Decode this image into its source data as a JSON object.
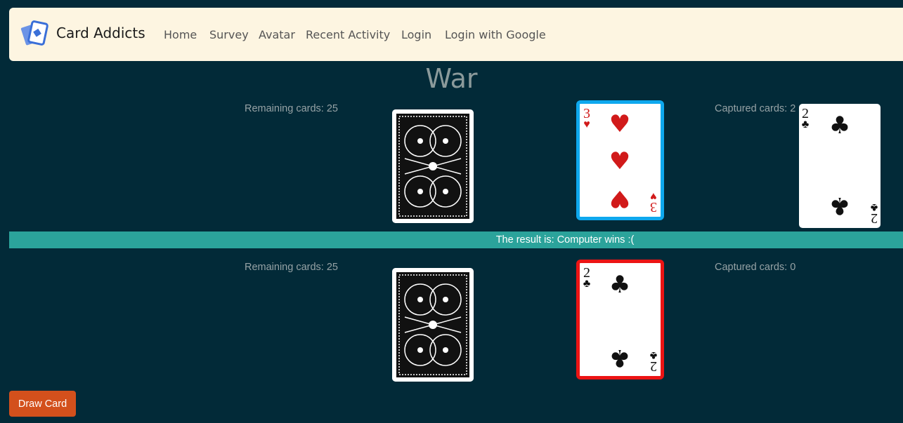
{
  "navbar": {
    "brand": "Card Addicts",
    "links": [
      "Home",
      "Survey",
      "Avatar",
      "Recent Activity",
      "Login",
      "Login with Google"
    ]
  },
  "page": {
    "title": "War"
  },
  "computer": {
    "remaining_label": "Remaining cards: 25",
    "captured_label": "Captured cards: 2",
    "played_card": {
      "rank": "3",
      "suit": "♥",
      "color": "red",
      "highlight": "#0ea8ee"
    },
    "captured_top_card": {
      "rank": "2",
      "suit": "♣",
      "color": "black"
    }
  },
  "result": {
    "text": "The result is: Computer wins :("
  },
  "player": {
    "remaining_label": "Remaining cards: 25",
    "captured_label": "Captured cards: 0",
    "played_card": {
      "rank": "2",
      "suit": "♣",
      "color": "black",
      "highlight": "#ec1414"
    }
  },
  "actions": {
    "draw_label": "Draw Card"
  },
  "colors": {
    "background": "#022a38",
    "navbar": "#fdf5e1",
    "result_bar": "#2ba39b",
    "draw_button": "#d3501c"
  },
  "icons": {
    "logo": "card-logo-icon",
    "card_back": "card-back-pattern"
  }
}
